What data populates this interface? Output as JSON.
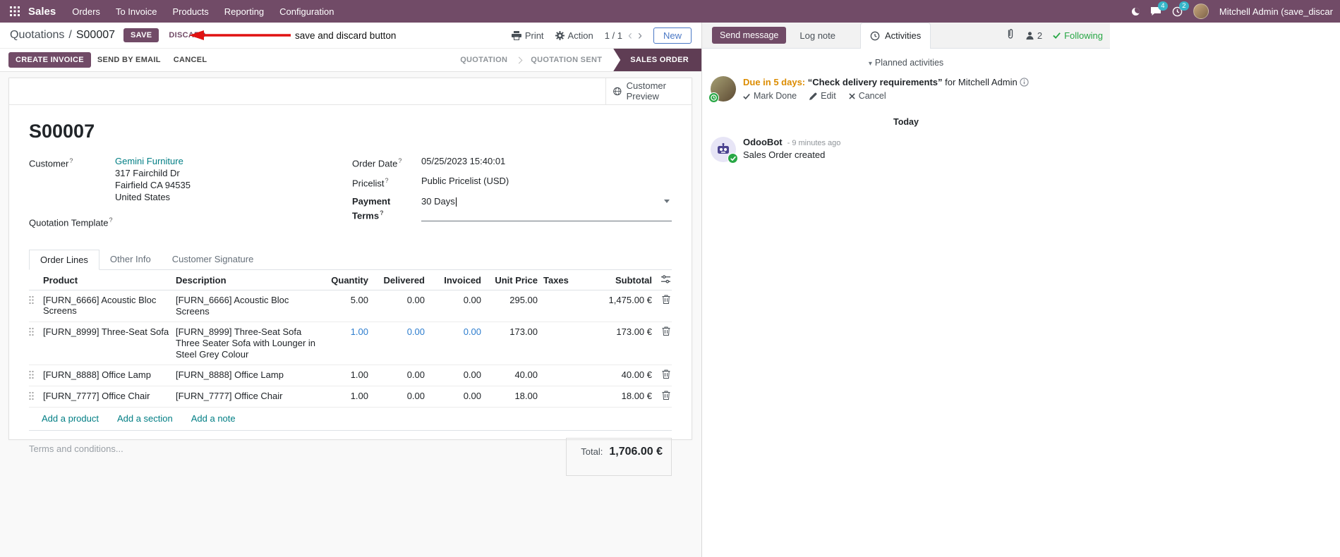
{
  "colors": {
    "brand_purple": "#714B67",
    "stage_active": "#5F3D54",
    "link_teal": "#017E84",
    "edited_blue": "#2D7DCE",
    "warning_orange": "#DC8C00",
    "success_green": "#28A745",
    "annotation_red": "#E01212",
    "nav_badge_cyan": "#36B5C9"
  },
  "nav": {
    "app_name": "Sales",
    "menus": [
      "Orders",
      "To Invoice",
      "Products",
      "Reporting",
      "Configuration"
    ],
    "message_count": "4",
    "activity_count": "2",
    "user_name": "Mitchell Admin (save_discar"
  },
  "breadcrumb": {
    "parent": "Quotations",
    "separator": "/",
    "current": "S00007",
    "save": "SAVE",
    "discard": "DISCARD"
  },
  "annotation": {
    "text": "save and discard button"
  },
  "controls": {
    "print": "Print",
    "action": "Action",
    "pager": "1 / 1",
    "new": "New"
  },
  "statusbar": {
    "buttons": [
      "CREATE INVOICE",
      "SEND BY EMAIL",
      "CANCEL"
    ],
    "stages": [
      "QUOTATION",
      "QUOTATION SENT",
      "SALES ORDER"
    ],
    "active_stage": "SALES ORDER"
  },
  "sheet": {
    "customer_preview": "Customer Preview",
    "title": "S00007",
    "help_mark": "?",
    "left": {
      "customer_label": "Customer",
      "customer_value": "Gemini Furniture",
      "address_lines": [
        "317 Fairchild Dr",
        "Fairfield CA 94535",
        "United States"
      ],
      "quotation_template_label": "Quotation Template"
    },
    "right": {
      "order_date_label": "Order Date",
      "order_date_value": "05/25/2023 15:40:01",
      "pricelist_label": "Pricelist",
      "pricelist_value": "Public Pricelist (USD)",
      "payment_terms_label": "Payment Terms",
      "payment_terms_value": "30 Days"
    },
    "tabs": [
      "Order Lines",
      "Other Info",
      "Customer Signature"
    ],
    "table": {
      "headers": {
        "product": "Product",
        "description": "Description",
        "quantity": "Quantity",
        "delivered": "Delivered",
        "invoiced": "Invoiced",
        "unit_price": "Unit Price",
        "taxes": "Taxes",
        "subtotal": "Subtotal"
      },
      "rows": [
        {
          "product": "[FURN_6666] Acoustic Bloc Screens",
          "description_lines": [
            "[FURN_6666] Acoustic Bloc Screens"
          ],
          "quantity": "5.00",
          "delivered": "0.00",
          "invoiced": "0.00",
          "unit_price": "295.00",
          "taxes": "",
          "subtotal": "1,475.00 €",
          "edited": false
        },
        {
          "product": "[FURN_8999] Three-Seat Sofa",
          "description_lines": [
            "[FURN_8999] Three-Seat Sofa",
            "Three Seater Sofa with Lounger in Steel Grey Colour"
          ],
          "quantity": "1.00",
          "delivered": "0.00",
          "invoiced": "0.00",
          "unit_price": "173.00",
          "taxes": "",
          "subtotal": "173.00 €",
          "edited": true
        },
        {
          "product": "[FURN_8888] Office Lamp",
          "description_lines": [
            "[FURN_8888] Office Lamp"
          ],
          "quantity": "1.00",
          "delivered": "0.00",
          "invoiced": "0.00",
          "unit_price": "40.00",
          "taxes": "",
          "subtotal": "40.00 €",
          "edited": false
        },
        {
          "product": "[FURN_7777] Office Chair",
          "description_lines": [
            "[FURN_7777] Office Chair"
          ],
          "quantity": "1.00",
          "delivered": "0.00",
          "invoiced": "0.00",
          "unit_price": "18.00",
          "taxes": "",
          "subtotal": "18.00 €",
          "edited": false
        }
      ],
      "footer_links": [
        "Add a product",
        "Add a section",
        "Add a note"
      ]
    },
    "terms_placeholder": "Terms and conditions...",
    "total_label": "Total:",
    "total_value": "1,706.00 €"
  },
  "chatter": {
    "send_message": "Send message",
    "log_note": "Log note",
    "activities_tab": "Activities",
    "followers_count": "2",
    "following": "Following",
    "planned_header": "Planned activities",
    "activity": {
      "due": "Due in 5 days:",
      "summary": "“Check delivery requirements”",
      "assignee": "for Mitchell Admin",
      "mark_done": "Mark Done",
      "edit": "Edit",
      "cancel": "Cancel"
    },
    "date_divider": "Today",
    "message": {
      "author": "OdooBot",
      "timestamp": "- 9 minutes ago",
      "body": "Sales Order created"
    }
  }
}
